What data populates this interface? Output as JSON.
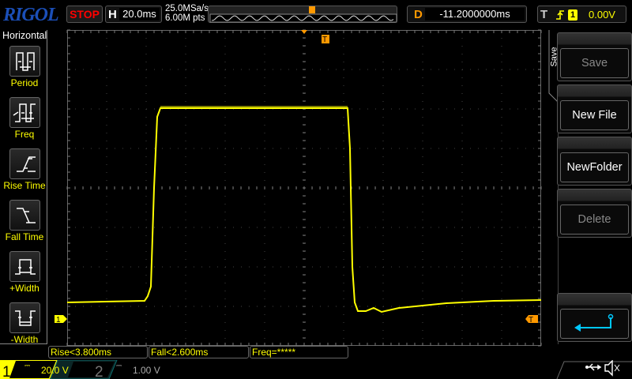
{
  "header": {
    "logo": "RIGOL",
    "run_state": "STOP",
    "h_label": "H",
    "timebase": "20.0ms",
    "sample_rate": "25.0MSa/s",
    "memory_depth": "6.00M pts",
    "d_label": "D",
    "delay": "-11.2000000ms",
    "t_label": "T",
    "trigger_source": "1",
    "trigger_level": "0.00V",
    "trigger_slope": "rising-edge-icon"
  },
  "left_menu": {
    "title": "Horizontal",
    "items": [
      {
        "label": "Period",
        "icon": "period-icon"
      },
      {
        "label": "Freq",
        "icon": "freq-icon"
      },
      {
        "label": "Rise Time",
        "icon": "rise-time-icon"
      },
      {
        "label": "Fall Time",
        "icon": "fall-time-icon"
      },
      {
        "label": "+Width",
        "icon": "plus-width-icon"
      },
      {
        "label": "-Width",
        "icon": "minus-width-icon"
      }
    ]
  },
  "right_menu": {
    "title": "Save",
    "items": [
      {
        "label": "Save",
        "enabled": false
      },
      {
        "label": "New File",
        "enabled": true
      },
      {
        "label": "NewFolder",
        "enabled": true
      },
      {
        "label": "Delete",
        "enabled": false
      }
    ],
    "back_icon": "return-arrow-icon"
  },
  "measurements": [
    "Rise<3.800ms",
    "Fall<2.600ms",
    "Freq=*****"
  ],
  "channels": [
    {
      "num": "1",
      "scale": "20.0 V",
      "coupling": "DC",
      "color": "#ffff00",
      "active": true
    },
    {
      "num": "2",
      "scale": "1.00 V",
      "coupling": "DC",
      "color": "#00b0b0",
      "active": false
    }
  ],
  "markers": {
    "ch1": "1",
    "trigger": "T"
  },
  "status_icons": [
    "usb-icon",
    "sound-muted-icon"
  ],
  "colors": {
    "ch1": "#ffff00",
    "trigger": "#ff9900",
    "back": "#00c8ff"
  }
}
